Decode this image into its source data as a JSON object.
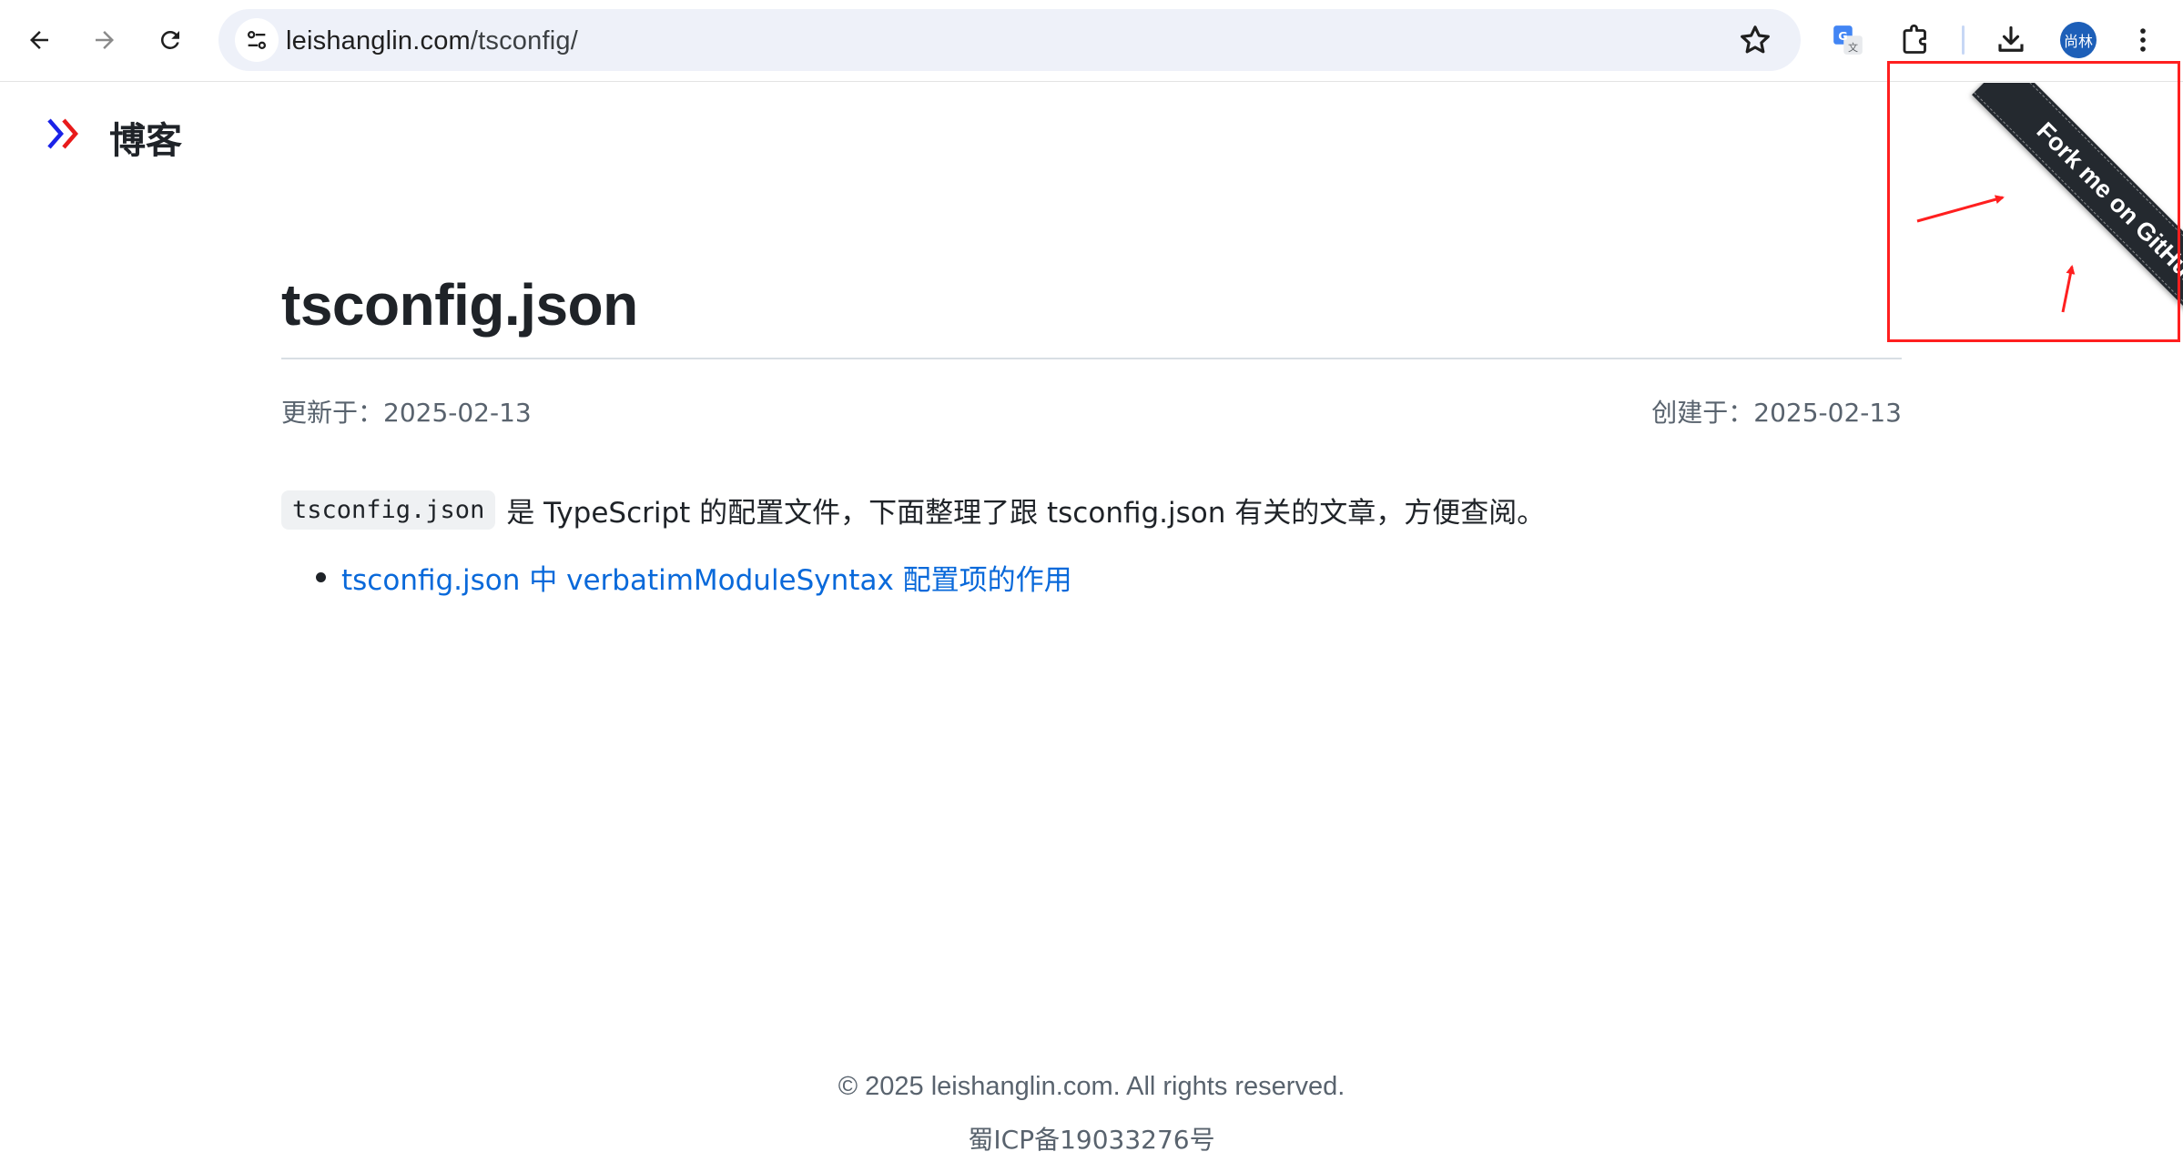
{
  "browser": {
    "url_domain": "leishanglin.com",
    "url_path": "/tsconfig/",
    "profile_initials": "尚林",
    "icons": [
      "back-arrow-icon",
      "forward-arrow-icon",
      "reload-icon",
      "site-settings-icon",
      "bookmark-star-icon",
      "translate-icon",
      "extensions-puzzle-icon",
      "download-icon",
      "more-vertical-icon"
    ]
  },
  "site": {
    "brand": "博客",
    "logo_colors": [
      "#1a22e8",
      "#e81a1a"
    ]
  },
  "article": {
    "title": "tsconfig.json",
    "updated": "更新于：2025-02-13",
    "created": "创建于：2025-02-13",
    "intro_code": "tsconfig.json",
    "intro_text": "是 TypeScript 的配置文件，下面整理了跟 tsconfig.json 有关的文章，方便查阅。",
    "links": [
      {
        "label": "tsconfig.json 中 verbatimModuleSyntax 配置项的作用"
      }
    ]
  },
  "ribbon": {
    "label": "Fork me on GitHub"
  },
  "annotation": {
    "color": "#ff1f1f"
  },
  "footer": {
    "copyright": "© 2025 leishanglin.com. All rights reserved.",
    "icp": "蜀ICP备19033276号"
  }
}
